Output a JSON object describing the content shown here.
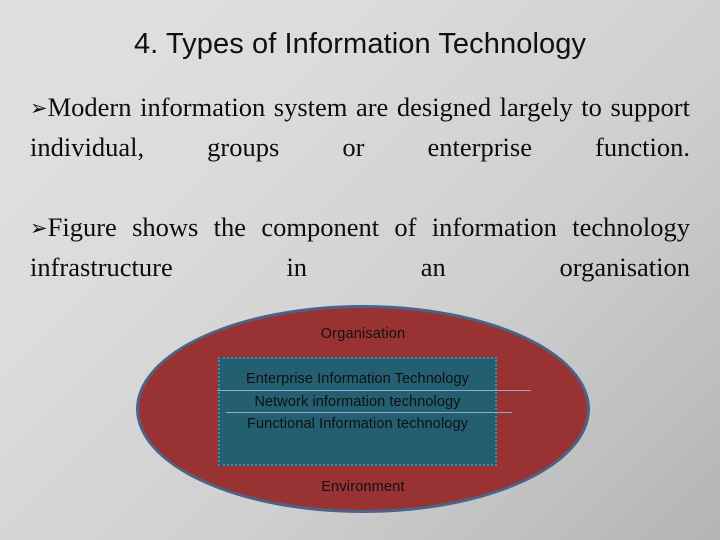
{
  "slide": {
    "title": "4. Types of Information Technology",
    "background_color_top": "#e0e0e0",
    "background_color_bottom": "#b4b4b4"
  },
  "body": {
    "bullet_marker": "➢",
    "bullets": [
      "Modern information system are designed largely to support individual, groups or enterprise function.",
      "Figure shows the component of information technology infrastructure in an organisation"
    ]
  },
  "diagram": {
    "ellipse_label": "Organisation",
    "ellipse_fill": "#993333",
    "ellipse_border": "#4a6487",
    "inner_box_fill": "#235f70",
    "inner_box_border": "#5a7f93",
    "divider_color": "#8fa8cd",
    "layers": [
      "Enterprise Information Technology",
      "Network information technology",
      "Functional Information technology"
    ],
    "bottom_label": "Environment"
  }
}
